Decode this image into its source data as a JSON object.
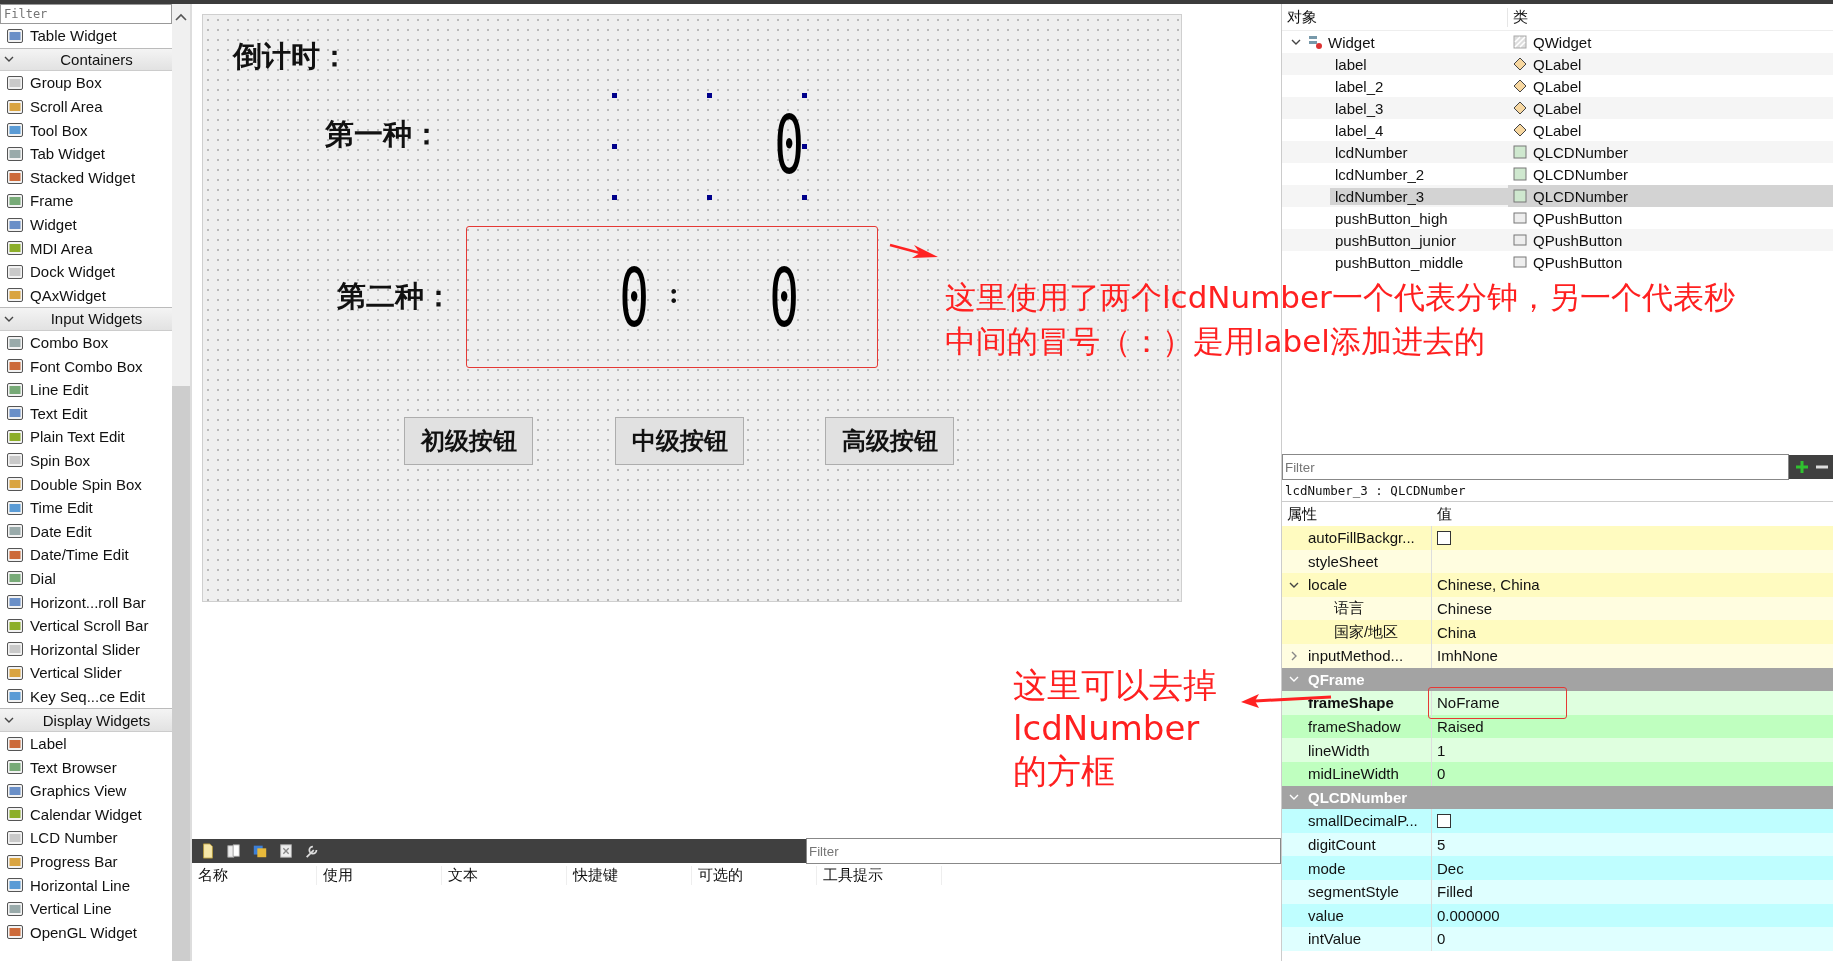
{
  "widget_box": {
    "filter_placeholder": "Filter",
    "items": [
      {
        "kind": "widget",
        "label": "Table Widget"
      },
      {
        "kind": "category",
        "label": "Containers",
        "expanded": true
      },
      {
        "kind": "widget",
        "label": "Group Box"
      },
      {
        "kind": "widget",
        "label": "Scroll Area"
      },
      {
        "kind": "widget",
        "label": "Tool Box"
      },
      {
        "kind": "widget",
        "label": "Tab Widget"
      },
      {
        "kind": "widget",
        "label": "Stacked Widget"
      },
      {
        "kind": "widget",
        "label": "Frame"
      },
      {
        "kind": "widget",
        "label": "Widget"
      },
      {
        "kind": "widget",
        "label": "MDI Area"
      },
      {
        "kind": "widget",
        "label": "Dock Widget"
      },
      {
        "kind": "widget",
        "label": "QAxWidget"
      },
      {
        "kind": "category",
        "label": "Input Widgets",
        "expanded": true
      },
      {
        "kind": "widget",
        "label": "Combo Box"
      },
      {
        "kind": "widget",
        "label": "Font Combo Box"
      },
      {
        "kind": "widget",
        "label": "Line Edit"
      },
      {
        "kind": "widget",
        "label": "Text Edit"
      },
      {
        "kind": "widget",
        "label": "Plain Text Edit"
      },
      {
        "kind": "widget",
        "label": "Spin Box"
      },
      {
        "kind": "widget",
        "label": "Double Spin Box"
      },
      {
        "kind": "widget",
        "label": "Time Edit"
      },
      {
        "kind": "widget",
        "label": "Date Edit"
      },
      {
        "kind": "widget",
        "label": "Date/Time Edit"
      },
      {
        "kind": "widget",
        "label": "Dial"
      },
      {
        "kind": "widget",
        "label": "Horizont...roll Bar"
      },
      {
        "kind": "widget",
        "label": "Vertical Scroll Bar"
      },
      {
        "kind": "widget",
        "label": "Horizontal Slider"
      },
      {
        "kind": "widget",
        "label": "Vertical Slider"
      },
      {
        "kind": "widget",
        "label": "Key Seq...ce Edit"
      },
      {
        "kind": "category",
        "label": "Display Widgets",
        "expanded": true
      },
      {
        "kind": "widget",
        "label": "Label"
      },
      {
        "kind": "widget",
        "label": "Text Browser"
      },
      {
        "kind": "widget",
        "label": "Graphics View"
      },
      {
        "kind": "widget",
        "label": "Calendar Widget"
      },
      {
        "kind": "widget",
        "label": "LCD Number"
      },
      {
        "kind": "widget",
        "label": "Progress Bar"
      },
      {
        "kind": "widget",
        "label": "Horizontal Line"
      },
      {
        "kind": "widget",
        "label": "Vertical Line"
      },
      {
        "kind": "widget",
        "label": "OpenGL Widget"
      }
    ]
  },
  "form": {
    "title": "倒计时：",
    "row1": {
      "label": "第一种：",
      "lcd": {
        "value": "0",
        "selected": true
      }
    },
    "row2": {
      "label": "第二种：",
      "minutes": {
        "value": "0",
        "selected": false
      },
      "colon": ":",
      "seconds": {
        "value": "0",
        "selected": false
      }
    },
    "buttons": [
      "初级按钮",
      "中级按钮",
      "高级按钮"
    ]
  },
  "action_editor": {
    "filter_placeholder": "Filter",
    "columns": [
      "名称",
      "使用",
      "文本",
      "快捷键",
      "可选的",
      "工具提示"
    ]
  },
  "object_inspector": {
    "columns": [
      "对象",
      "类"
    ],
    "tree": [
      {
        "name": "Widget",
        "class": "QWidget",
        "expanded": true,
        "selected": false,
        "children": [
          {
            "name": "label",
            "class": "QLabel",
            "selected": false
          },
          {
            "name": "label_2",
            "class": "QLabel",
            "selected": false
          },
          {
            "name": "label_3",
            "class": "QLabel",
            "selected": false
          },
          {
            "name": "label_4",
            "class": "QLabel",
            "selected": false
          },
          {
            "name": "lcdNumber",
            "class": "QLCDNumber",
            "selected": false
          },
          {
            "name": "lcdNumber_2",
            "class": "QLCDNumber",
            "selected": false
          },
          {
            "name": "lcdNumber_3",
            "class": "QLCDNumber",
            "selected": true
          },
          {
            "name": "pushButton_high",
            "class": "QPushButton",
            "selected": false
          },
          {
            "name": "pushButton_junior",
            "class": "QPushButton",
            "selected": false
          },
          {
            "name": "pushButton_middle",
            "class": "QPushButton",
            "selected": false
          }
        ]
      }
    ]
  },
  "property_editor": {
    "filter_placeholder": "Filter",
    "caption": "lcdNumber_3 : QLCDNumber",
    "columns": [
      "属性",
      "值"
    ],
    "groups": [
      {
        "color": "#fffbc0",
        "rows": [
          {
            "kind": "check",
            "name": "autoFillBackgr...",
            "checked": false,
            "changed": false
          },
          {
            "kind": "text",
            "name": "styleSheet",
            "changed": false
          },
          {
            "kind": "text",
            "name": "locale",
            "value": "Chinese, China",
            "expanded": true,
            "changed": false,
            "children": [
              {
                "kind": "text",
                "name": "语言",
                "value": "Chinese",
                "changed": false
              },
              {
                "kind": "text",
                "name": "国家/地区",
                "value": "China",
                "changed": false
              }
            ]
          },
          {
            "kind": "text",
            "name": "inputMethod...",
            "value": "ImhNone",
            "expanded": false,
            "changed": false
          }
        ]
      },
      {
        "name": "QFrame",
        "expanded": true,
        "color": "#bfffbf",
        "rows": [
          {
            "kind": "text",
            "name": "frameShape",
            "value": "NoFrame",
            "changed": true
          },
          {
            "kind": "text",
            "name": "frameShadow",
            "value": "Raised",
            "changed": false
          },
          {
            "kind": "text",
            "name": "lineWidth",
            "value": "1",
            "changed": false
          },
          {
            "kind": "text",
            "name": "midLineWidth",
            "value": "0",
            "changed": false
          }
        ]
      },
      {
        "name": "QLCDNumber",
        "expanded": true,
        "color": "#bffeff",
        "rows": [
          {
            "kind": "check",
            "name": "smallDecimalP...",
            "checked": false,
            "changed": false
          },
          {
            "kind": "text",
            "name": "digitCount",
            "value": "5",
            "changed": false
          },
          {
            "kind": "text",
            "name": "mode",
            "value": "Dec",
            "changed": false
          },
          {
            "kind": "text",
            "name": "segmentStyle",
            "value": "Filled",
            "changed": false
          },
          {
            "kind": "text",
            "name": "value",
            "value": "0.000000",
            "changed": false
          },
          {
            "kind": "text",
            "name": "intValue",
            "value": "0",
            "changed": false
          }
        ]
      }
    ]
  },
  "annotations": [
    {
      "lines": [
        "这里使用了两个lcdNumber一个代表分钟，另一个代表秒",
        "中间的冒号（：）是用label添加进去的"
      ]
    },
    {
      "lines": [
        "这里可以去掉",
        "lcdNumber",
        "的方框"
      ]
    }
  ]
}
